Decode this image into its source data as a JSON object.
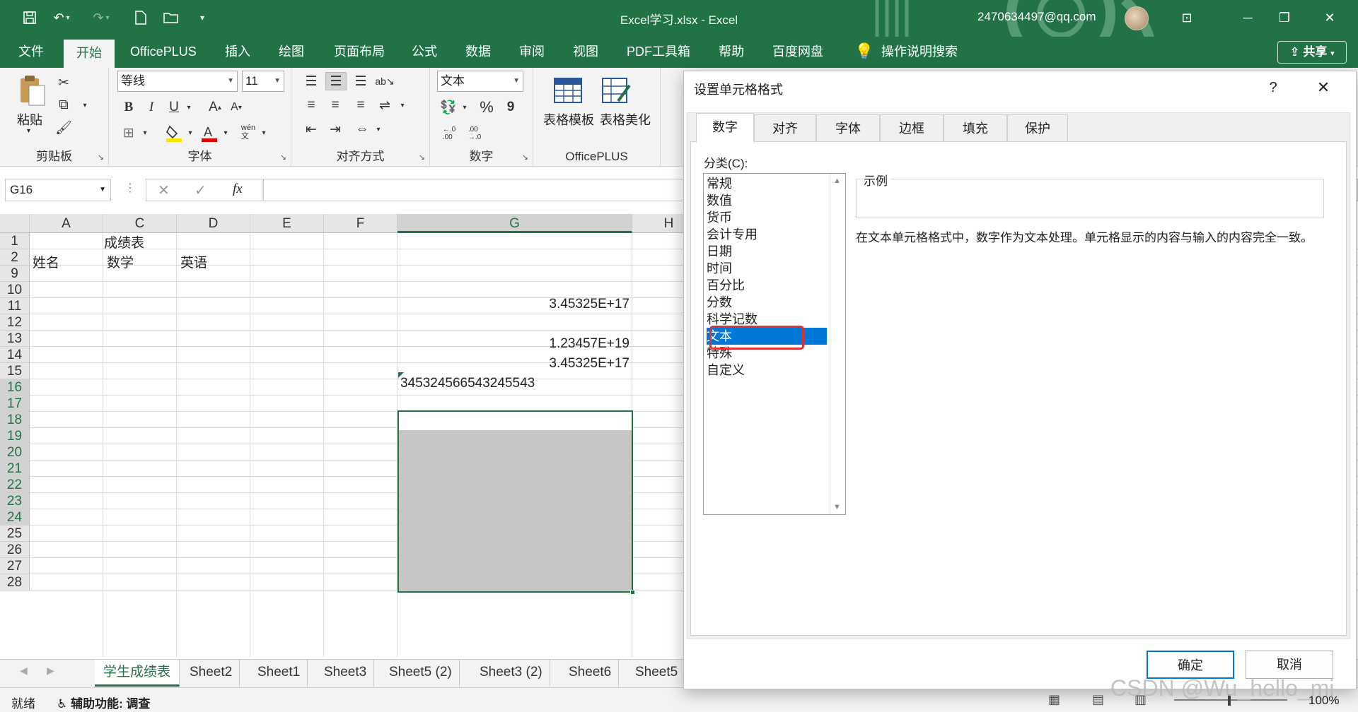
{
  "app": {
    "title": "Excel学习.xlsx  -  Excel",
    "account": "2470634497@qq.com"
  },
  "ribbon_tabs": [
    "文件",
    "开始",
    "OfficePLUS",
    "插入",
    "绘图",
    "页面布局",
    "公式",
    "数据",
    "审阅",
    "视图",
    "PDF工具箱",
    "帮助",
    "百度网盘"
  ],
  "search_label": "操作说明搜索",
  "share_label": "共享",
  "ribbon": {
    "clipboard": {
      "paste": "粘贴",
      "label": "剪贴板"
    },
    "font": {
      "name": "等线",
      "size": "11",
      "label": "字体",
      "bold": "B",
      "italic": "I",
      "underline": "U",
      "pinyin": "wén\n文"
    },
    "alignment": {
      "label": "对齐方式"
    },
    "number": {
      "format": "文本",
      "label": "数字",
      "percent": "%",
      "comma": "9"
    },
    "officeplus": {
      "template": "表格模板",
      "beautify": "表格美化",
      "label": "OfficePLUS"
    }
  },
  "name_box": "G16",
  "fx_label": "fx",
  "columns": [
    "A",
    "C",
    "D",
    "E",
    "F",
    "G",
    "H"
  ],
  "rows": [
    "1",
    "2",
    "9",
    "10",
    "11",
    "12",
    "13",
    "14",
    "15",
    "16",
    "17",
    "18",
    "19",
    "20",
    "21",
    "22",
    "23",
    "24",
    "25",
    "26",
    "27",
    "28"
  ],
  "cells": {
    "c1": "成绩表",
    "a2": "姓名",
    "c2": "数学",
    "d2": "英语",
    "g10": "3.45325E+17",
    "g12": "1.23457E+19",
    "g13": "3.45325E+17",
    "g14": "345324566543245543"
  },
  "sheet_tabs": [
    "学生成绩表",
    "Sheet2",
    "Sheet1",
    "Sheet3",
    "Sheet5 (2)",
    "Sheet3 (2)",
    "Sheet6",
    "Sheet5"
  ],
  "status": {
    "ready": "就绪",
    "accessibility": "辅助功能: 调查",
    "zoom": "100%"
  },
  "dialog": {
    "title": "设置单元格格式",
    "help": "?",
    "tabs": [
      "数字",
      "对齐",
      "字体",
      "边框",
      "填充",
      "保护"
    ],
    "category_label": "分类(C):",
    "categories": [
      "常规",
      "数值",
      "货币",
      "会计专用",
      "日期",
      "时间",
      "百分比",
      "分数",
      "科学记数",
      "文本",
      "特殊",
      "自定义"
    ],
    "selected_category": "文本",
    "sample_label": "示例",
    "description": "在文本单元格格式中，数字作为文本处理。单元格显示的内容与输入的内容完全一致。",
    "ok": "确定",
    "cancel": "取消"
  },
  "watermark": "CSDN @Wu_hello_mi"
}
